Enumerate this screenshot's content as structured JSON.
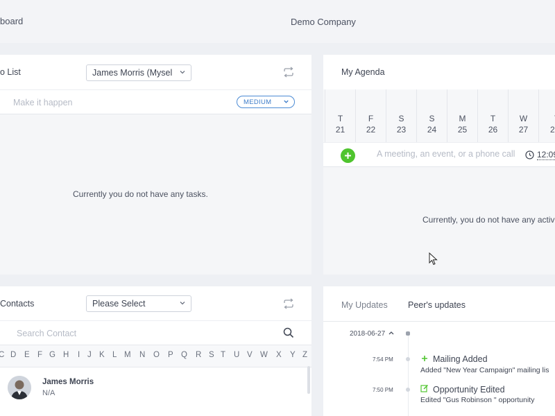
{
  "topbar": {
    "breadcrumb": "board",
    "company": "Demo Company"
  },
  "todo": {
    "title": "o List",
    "assignee_select": "James Morris (Mysel",
    "task_placeholder": "Make it happen",
    "priority": "MEDIUM",
    "empty_message": "Currently you do not have any tasks."
  },
  "agenda": {
    "title": "My Agenda",
    "days": [
      {
        "letter": "T",
        "date": "21"
      },
      {
        "letter": "F",
        "date": "22"
      },
      {
        "letter": "S",
        "date": "23"
      },
      {
        "letter": "S",
        "date": "24"
      },
      {
        "letter": "M",
        "date": "25"
      },
      {
        "letter": "T",
        "date": "26"
      },
      {
        "letter": "W",
        "date": "27"
      },
      {
        "letter": "T",
        "date": "2"
      }
    ],
    "event_placeholder": "A meeting, an event, or a phone call",
    "time_value": "12:09",
    "empty_message": "Currently, you do not have any activ"
  },
  "contacts": {
    "title": "Contacts",
    "select_value": "Please Select",
    "search_placeholder": "Search Contact",
    "letters": [
      "C",
      "D",
      "E",
      "F",
      "G",
      "H",
      "I",
      "J",
      "K",
      "L",
      "M",
      "N",
      "O",
      "P",
      "Q",
      "R",
      "S",
      "T",
      "U",
      "V",
      "W",
      "X",
      "Y",
      "Z"
    ],
    "items": [
      {
        "name": "James Morris",
        "detail": "N/A"
      }
    ]
  },
  "updates": {
    "tabs": [
      {
        "label": "My Updates",
        "active": false
      },
      {
        "label": "Peer's updates",
        "active": true
      }
    ],
    "date": "2018-06-27",
    "entries": [
      {
        "time": "7:54 PM",
        "icon": "plus-icon",
        "title": "Mailing Added",
        "subtitle": "Added \"New Year Campaign\" mailing lis"
      },
      {
        "time": "7:50 PM",
        "icon": "edit-icon",
        "title": "Opportunity Edited",
        "subtitle": "Edited \"Gus Robinson \" opportunity"
      }
    ]
  },
  "colors": {
    "accent_blue": "#3d7cc9",
    "add_green": "#4fc42e",
    "panel_header": "#ffffff",
    "background": "#eef0f4"
  }
}
